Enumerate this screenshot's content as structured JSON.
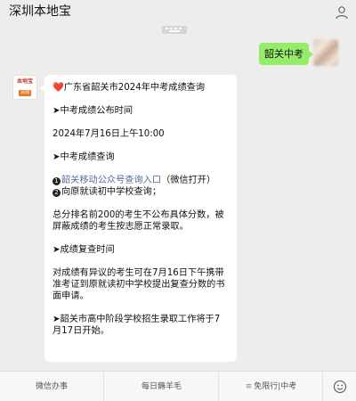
{
  "header": {
    "title": "深圳本地宝",
    "profile_icon": "person-icon"
  },
  "chat": {
    "user_message": "韶关中考",
    "bot_avatar": {
      "logo_text": "本地宝",
      "logo_tag": "深圳"
    },
    "bot_message": {
      "title": "广东省韶关市2024年中考成绩查询",
      "section1_heading": "➤中考成绩公布时间",
      "section1_body": "2024年7月16日上午10:00",
      "section2_heading": "➤中考成绩查询",
      "item1_num": "1",
      "item1_link": "韶关移动公众号查询入口",
      "item1_suffix": "（微信打开）",
      "item2_num": "2",
      "item2_text": "向原就读初中学校查询；",
      "note": "总分排名前200的考生不公布具体分数，被屏蔽成绩的考生按志愿正常录取。",
      "section3_heading": "➤成绩复查时间",
      "section3_body": "对成绩有异议的考生可在7月16日下午携带准考证到原就读初中学校提出复查分数的书面申请。",
      "section4_body": "➤韶关市高中阶段学校招生录取工作将于7月17日开始。"
    }
  },
  "bottom_bar": {
    "menu1": "微信办事",
    "menu2": "每日薅羊毛",
    "menu3_glyph": "≡",
    "menu3": "免限行|中考",
    "emoji_icon": "emoji-icon"
  }
}
